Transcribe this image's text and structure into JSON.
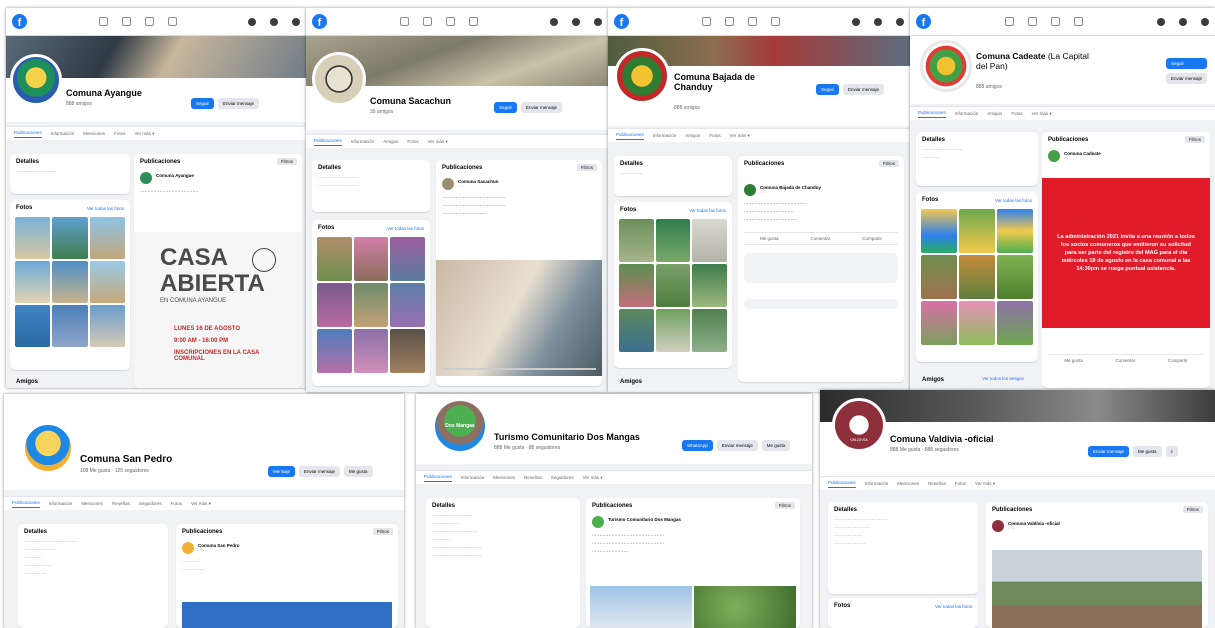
{
  "common": {
    "tabs": [
      "Publicaciones",
      "Información",
      "Menciones",
      "Reseñas",
      "Seguidores",
      "Fotos",
      "Ver más ▾"
    ],
    "details": "Detalles",
    "posts": "Publicaciones",
    "photos": "Fotos",
    "see_all_photos": "Ver todas las fotos",
    "filters": "Filtros",
    "follow": "Seguir",
    "message": "Enviar mensaje",
    "friends": "Amigos",
    "see_all_friends": "Ver todos los amigos",
    "like": "Me gusta",
    "comment": "Comentar",
    "share": "Compartir"
  },
  "panels": {
    "ayangue": {
      "name": "Comuna Ayangue",
      "sub": "888 amigos",
      "post_author": "Comuna Ayangue",
      "flyer_line1": "CASA",
      "flyer_line2": "ABIERTA",
      "flyer_line3": "EN COMUNA AYANGUE",
      "flyer_line4": "LUNES 16 DE AGOSTO",
      "flyer_line5": "9:00 AM - 16:00 PM",
      "flyer_line6": "INSCRIPCIONES EN LA CASA COMUNAL"
    },
    "sacachun": {
      "name": "Comuna Sacachun",
      "sub": "35 amigos",
      "post_author": "Comuna Sacachun"
    },
    "chanduy": {
      "name": "Comuna Bajada de Chanduy",
      "sub": "888 amigos",
      "post_author": "Comuna Bajada de Chanduy"
    },
    "cadeate": {
      "name": "Comuna Cadeate",
      "name_suffix": "(La Capital del Pan)",
      "sub": "888 amigos",
      "red_post": "La administración 2021 invita a una reunión a todos los socios comuneros que emitieron su solicitud para ser parte del registro del MAG para el día miércoles 18 de agosto en la casa comunal a las 14:30pm se ruega puntual asistencia."
    },
    "san_pedro": {
      "name": "Comuna San Pedro",
      "sub": "108 Me gusta · 125 seguidores",
      "message_btn": "Mensaje",
      "post_author": "Comuna San Pedro"
    },
    "dos_mangas": {
      "name": "Turismo Comunitario Dos Mangas",
      "sub": "888 Me gusta · 88 seguidores",
      "logo_text": "Dos Mangas",
      "post_author": "Turismo Comunitario Dos Mangas"
    },
    "valdivia": {
      "name": "Comuna Valdivia -oficial",
      "sub": "888 Me gusta · 888 seguidores",
      "logo_text": "VALDIVIA",
      "post_author": "Comuna Valdivia -oficial"
    }
  }
}
